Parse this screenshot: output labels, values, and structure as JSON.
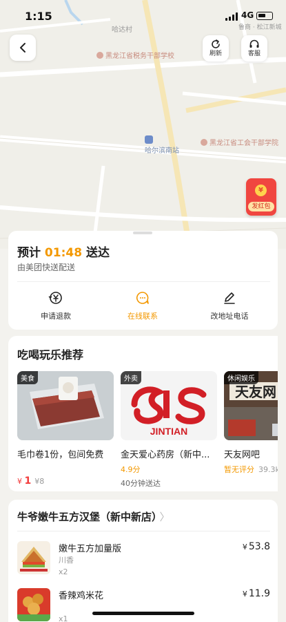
{
  "status_bar": {
    "time": "1:15",
    "network": "4G"
  },
  "map": {
    "labels": {
      "village": "哈达村",
      "school": "黑龙江省税务干部学校",
      "station": "哈尔滨南站",
      "union_school": "黑龙江省工会干部学院",
      "corner": "鲁商 · 松江新城"
    }
  },
  "toolbar": {
    "refresh_label": "刷新",
    "service_label": "客服"
  },
  "red_packet": {
    "coin": "¥",
    "label": "发红包"
  },
  "delivery": {
    "eta_prefix": "预计",
    "eta_time": "01:48",
    "eta_suffix": "送达",
    "rider": "由美团快送配送",
    "actions": [
      {
        "label": "申请退款",
        "icon": "refund-icon"
      },
      {
        "label": "在线联系",
        "icon": "chat-icon"
      },
      {
        "label": "改地址电话",
        "icon": "edit-icon"
      }
    ]
  },
  "recommend": {
    "title": "吃喝玩乐推荐",
    "items": [
      {
        "tag": "美食",
        "name": "毛巾卷1份，包间免费",
        "price_symbol": "¥",
        "price": "1",
        "original_price": "¥8"
      },
      {
        "tag": "外卖",
        "name": "金天爱心药房（新中...",
        "rating": "4.9分",
        "delivery_time": "40分钟送达",
        "logo_text": "JINTIAN"
      },
      {
        "tag": "休闲娱乐",
        "name": "天友网吧",
        "rating_text": "暂无评分",
        "distance": "39.3k",
        "sign_text": "天友网"
      }
    ]
  },
  "order": {
    "store": "牛爷嫩牛五方汉堡（新中新店）",
    "chevron": "〉",
    "items": [
      {
        "name": "嫩牛五方加量版",
        "spec": "川香",
        "qty": "x2",
        "currency": "¥",
        "price": "53.8"
      },
      {
        "name": "香辣鸡米花",
        "spec": "",
        "qty": "x1",
        "currency": "¥",
        "price": "11.9"
      }
    ]
  },
  "colors": {
    "accent": "#f39800",
    "price_red": "#f23b3b",
    "red_packet": "#f04640"
  }
}
